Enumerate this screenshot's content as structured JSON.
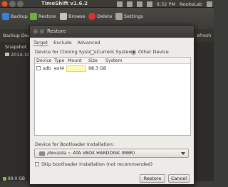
{
  "top_panel": {
    "title": "TimeShift v1.6.2",
    "clock": "6:32 PM",
    "user": "NoobsLab"
  },
  "app": {
    "toolbar": [
      "Backup",
      "Restore",
      "Browse",
      "Delete",
      "Settings"
    ],
    "refresh_label": "efresh",
    "device_label": "Backup Devic",
    "snapshot_header": "Snapshot",
    "snapshot_row": "2014-10-0",
    "status": "89.0 GB"
  },
  "dialog": {
    "title": "Restore",
    "tabs": [
      "Target",
      "Exclude",
      "Advanced"
    ],
    "cloning_label": "Device for Cloning System:",
    "radio_current": "Current System",
    "radio_other": "Other Device",
    "columns": [
      "Device",
      "Type",
      "Mount",
      "Size",
      "System"
    ],
    "rows": [
      {
        "device": "sdb",
        "type": "ext4",
        "mount": "",
        "size": "98.3 GB",
        "system": ""
      }
    ],
    "boot_label": "Device for Bootloader Installation:",
    "boot_select": "/dev/sda ~ ATA VBOX HARDDISK (MBR)",
    "skip_label": "Skip bootloader installation (not recommended)",
    "restore_button": "Restore",
    "cancel_button": "Cancel"
  },
  "colors": {
    "accent_delete": "#d9342b",
    "accent_restore": "#6fae3f",
    "mount_highlight": "#fff9b3"
  }
}
